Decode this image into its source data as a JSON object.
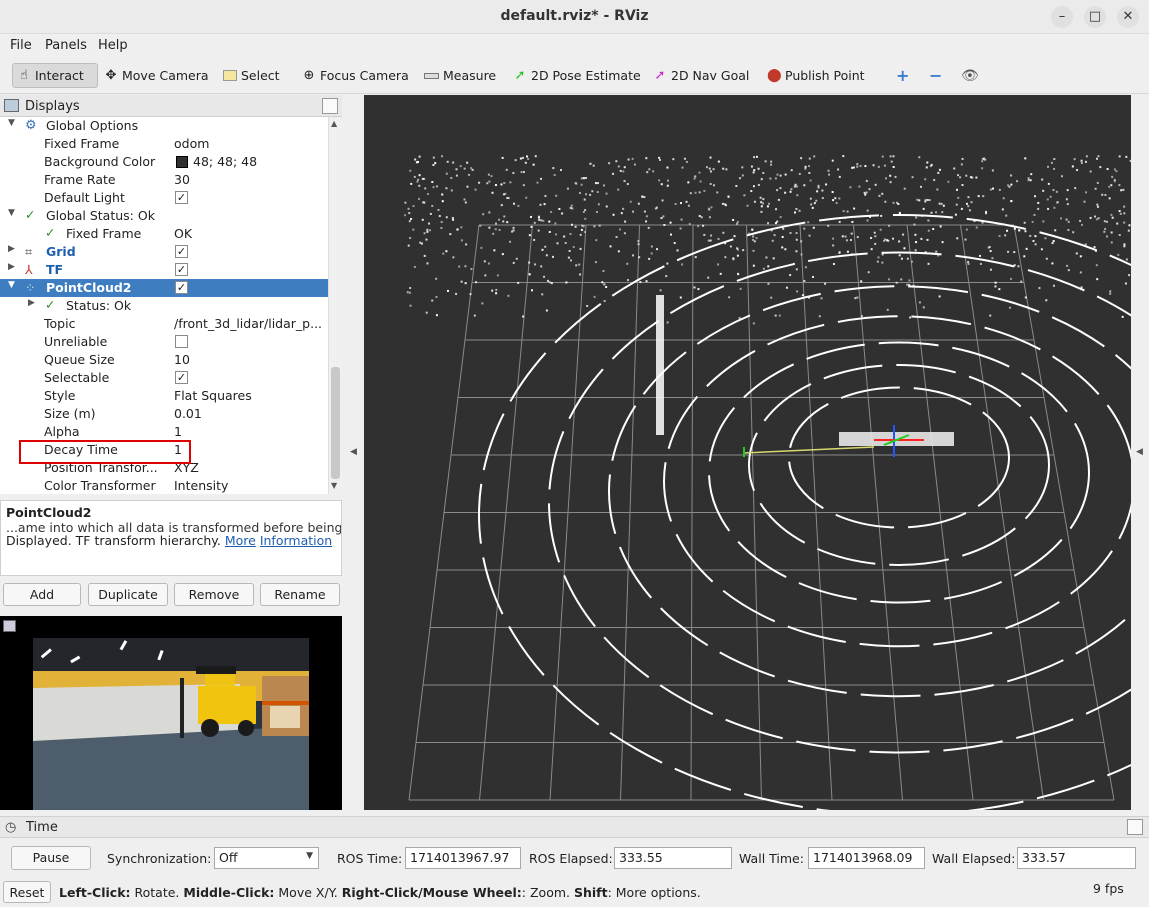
{
  "window": {
    "title": "default.rviz* - RViz"
  },
  "menu": [
    "File",
    "Panels",
    "Help"
  ],
  "toolbar": {
    "tools": [
      {
        "label": "Interact",
        "icon": "cursor-icon"
      },
      {
        "label": "Move Camera",
        "icon": "move-icon"
      },
      {
        "label": "Select",
        "icon": "select-icon"
      },
      {
        "label": "Focus Camera",
        "icon": "focus-icon"
      },
      {
        "label": "Measure",
        "icon": "ruler-icon"
      },
      {
        "label": "2D Pose Estimate",
        "icon": "pose-arrow-icon"
      },
      {
        "label": "2D Nav Goal",
        "icon": "nav-arrow-icon"
      },
      {
        "label": "Publish Point",
        "icon": "map-pin-icon"
      }
    ]
  },
  "displays": {
    "title": "Displays",
    "rows": [
      {
        "name": "Global Options",
        "value": ""
      },
      {
        "name": "Fixed Frame",
        "value": "odom"
      },
      {
        "name": "Background Color",
        "value": "48; 48; 48"
      },
      {
        "name": "Frame Rate",
        "value": "30"
      },
      {
        "name": "Default Light",
        "value": ""
      },
      {
        "name": "Global Status: Ok",
        "value": ""
      },
      {
        "name": "Fixed Frame",
        "value": "OK"
      },
      {
        "name": "Grid",
        "value": ""
      },
      {
        "name": "TF",
        "value": ""
      },
      {
        "name": "PointCloud2",
        "value": ""
      },
      {
        "name": "Status: Ok",
        "value": ""
      },
      {
        "name": "Topic",
        "value": "/front_3d_lidar/lidar_p..."
      },
      {
        "name": "Unreliable",
        "value": ""
      },
      {
        "name": "Queue Size",
        "value": "10"
      },
      {
        "name": "Selectable",
        "value": ""
      },
      {
        "name": "Style",
        "value": "Flat Squares"
      },
      {
        "name": "Size (m)",
        "value": "0.01"
      },
      {
        "name": "Alpha",
        "value": "1"
      },
      {
        "name": "Decay Time",
        "value": "1"
      },
      {
        "name": "Position Transfor...",
        "value": "XYZ"
      },
      {
        "name": "Color Transformer",
        "value": "Intensity"
      }
    ],
    "background_color": "#303030",
    "highlight_color": "#e00000",
    "selection_color": "#3d7dc0"
  },
  "description": {
    "title": "PointCloud2",
    "line1": "...ame into which all data is transformed before being",
    "line2_prefix": "Displayed.    TF transform hierarchy.",
    "link_more": "More",
    "link_info": "Information"
  },
  "buttons": {
    "add": "Add",
    "duplicate": "Duplicate",
    "remove": "Remove",
    "rename": "Rename"
  },
  "time": {
    "title": "Time",
    "pause": "Pause",
    "sync_label": "Synchronization:",
    "sync_value": "Off",
    "ros_time_label": "ROS Time:",
    "ros_time": "1714013967.97",
    "ros_elapsed_label": "ROS Elapsed:",
    "ros_elapsed": "333.55",
    "wall_time_label": "Wall Time:",
    "wall_time": "1714013968.09",
    "wall_elapsed_label": "Wall Elapsed:",
    "wall_elapsed": "333.57"
  },
  "status": {
    "reset": "Reset",
    "k1": "Left-Click:",
    "v1": " Rotate. ",
    "k2": "Middle-Click:",
    "v2": " Move X/Y. ",
    "k3": "Right-Click/Mouse Wheel:",
    "v3": ": Zoom. ",
    "k4": "Shift",
    "v4": ": More options.",
    "fps": "9 fps"
  }
}
